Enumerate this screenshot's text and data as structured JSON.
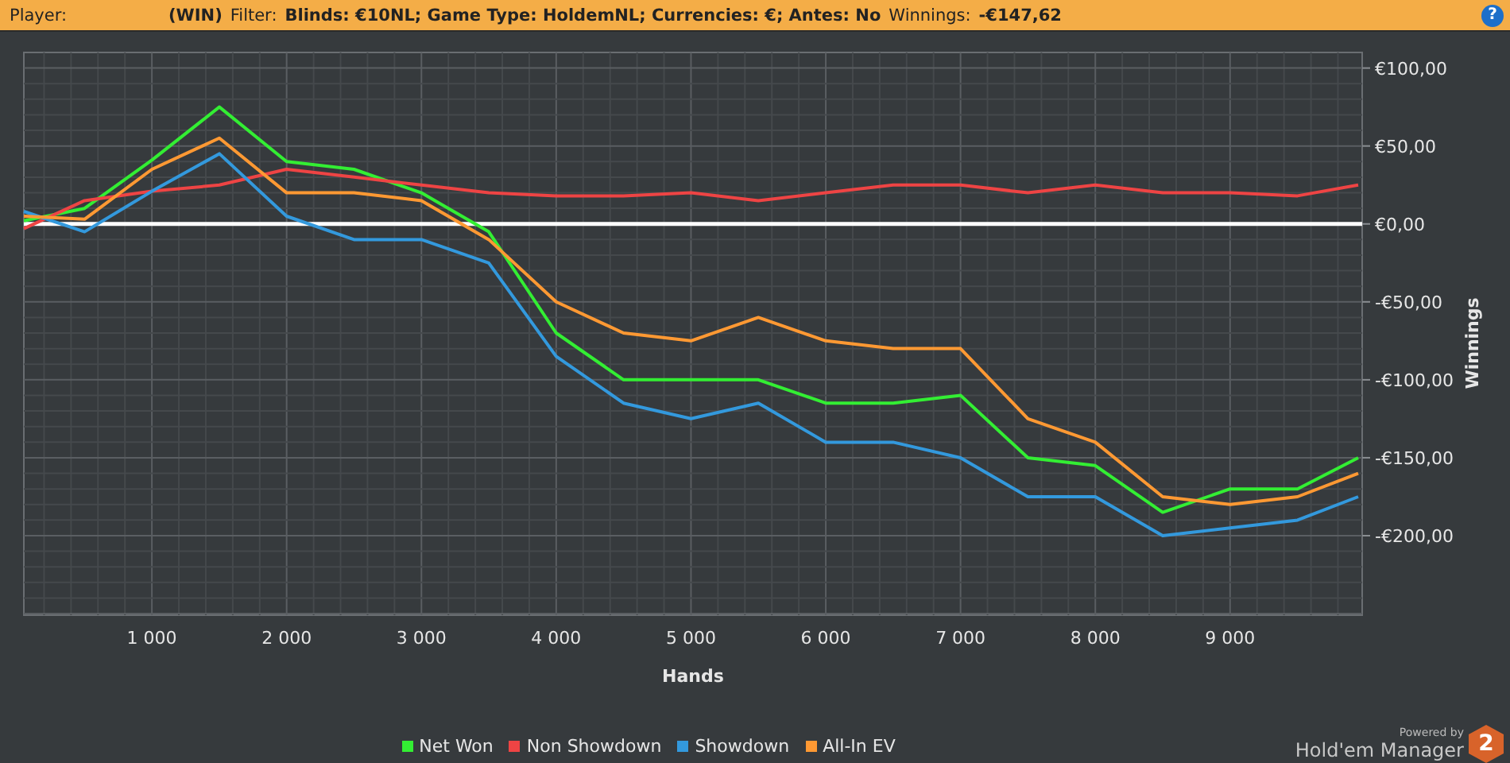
{
  "header": {
    "player_label": "Player:",
    "player_value": "(WIN)",
    "filter_label": "Filter:",
    "filter_value": "Blinds: €10NL; Game Type: HoldemNL; Currencies: €; Antes: No",
    "winnings_label": "Winnings:",
    "winnings_value": "-€147,62",
    "help_glyph": "?"
  },
  "chart": {
    "chart_data": {
      "type": "line",
      "xlabel": "Hands",
      "ylabel": "Winnings",
      "xlim": [
        50,
        9980
      ],
      "ylim": [
        -251,
        110
      ],
      "x": [
        50,
        500,
        1000,
        1500,
        2000,
        2500,
        3000,
        3500,
        4000,
        4500,
        5000,
        5500,
        6000,
        6500,
        7000,
        7500,
        8000,
        8500,
        9000,
        9500,
        9950
      ],
      "series": [
        {
          "name": "Net Won",
          "color": "#33ee33",
          "values": [
            2,
            10,
            41,
            75,
            40,
            35,
            20,
            -5,
            -70,
            -100,
            -100,
            -100,
            -115,
            -115,
            -110,
            -150,
            -155,
            -185,
            -170,
            -170,
            -150
          ]
        },
        {
          "name": "Non Showdown",
          "color": "#ee4444",
          "values": [
            -3,
            15,
            21,
            25,
            35,
            30,
            25,
            20,
            18,
            18,
            20,
            15,
            20,
            25,
            25,
            20,
            25,
            20,
            20,
            18,
            25
          ]
        },
        {
          "name": "Showdown",
          "color": "#3399dd",
          "values": [
            8,
            -5,
            21,
            45,
            5,
            -10,
            -10,
            -25,
            -85,
            -115,
            -125,
            -115,
            -140,
            -140,
            -150,
            -175,
            -175,
            -200,
            -195,
            -190,
            -175
          ]
        },
        {
          "name": "All-In EV",
          "color": "#ff9933",
          "values": [
            5,
            3,
            35,
            55,
            20,
            20,
            15,
            -10,
            -50,
            -70,
            -75,
            -60,
            -75,
            -80,
            -80,
            -125,
            -140,
            -175,
            -180,
            -175,
            -160
          ]
        }
      ],
      "xticks": [
        {
          "value": 1000,
          "label": "1 000"
        },
        {
          "value": 2000,
          "label": "2 000"
        },
        {
          "value": 3000,
          "label": "3 000"
        },
        {
          "value": 4000,
          "label": "4 000"
        },
        {
          "value": 5000,
          "label": "5 000"
        },
        {
          "value": 6000,
          "label": "6 000"
        },
        {
          "value": 7000,
          "label": "7 000"
        },
        {
          "value": 8000,
          "label": "8 000"
        },
        {
          "value": 9000,
          "label": "9 000"
        }
      ],
      "yticks": [
        {
          "value": 100,
          "label": "€100,00"
        },
        {
          "value": 50,
          "label": "€50,00"
        },
        {
          "value": 0,
          "label": "€0,00"
        },
        {
          "value": -50,
          "label": "-€50,00"
        },
        {
          "value": -100,
          "label": "-€100,00"
        },
        {
          "value": -150,
          "label": "-€150,00"
        },
        {
          "value": -200,
          "label": "-€200,00"
        }
      ],
      "grid": true,
      "ref_lines": [
        {
          "axis": "y",
          "value": 0
        }
      ]
    }
  },
  "brand": {
    "powered": "Powered by",
    "name": "Hold'em Manager",
    "badge": "2"
  }
}
